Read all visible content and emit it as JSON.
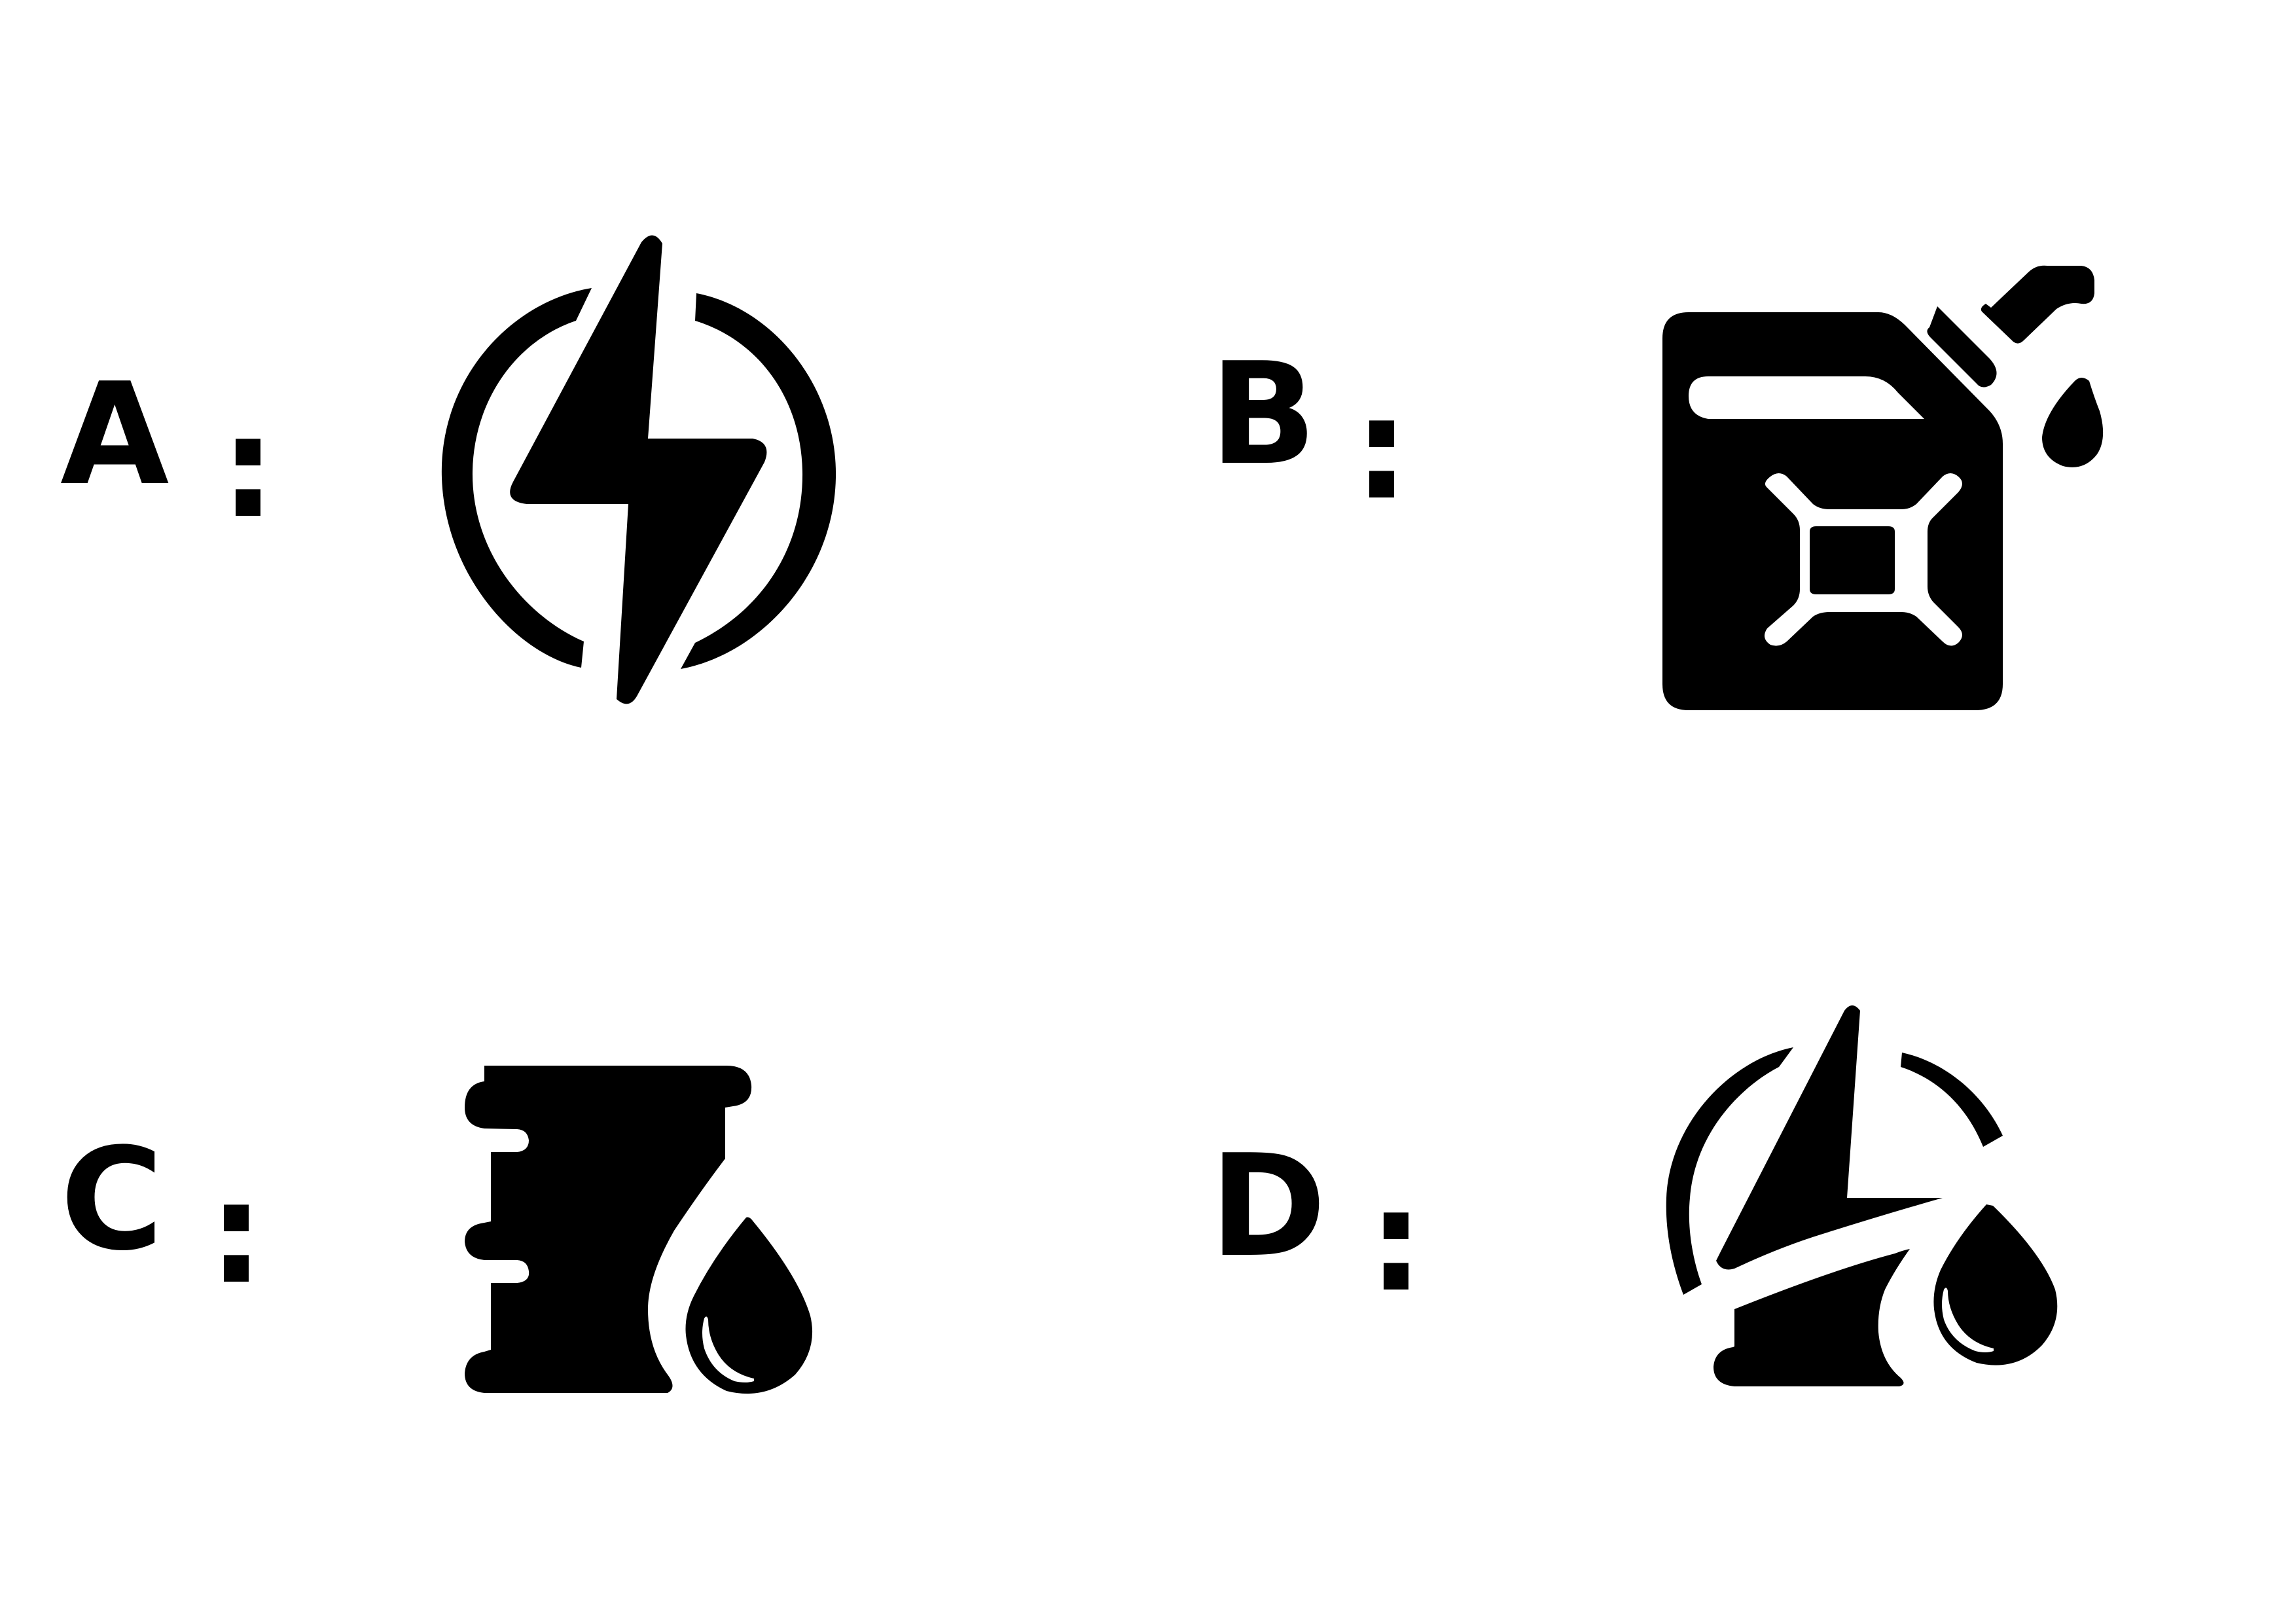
{
  "options": [
    {
      "letter": "A",
      "separator": ":",
      "icon": "energy-renewable-lightning-icon"
    },
    {
      "letter": "B",
      "separator": ":",
      "icon": "fuel-jerrycan-drip-icon"
    },
    {
      "letter": "C",
      "separator": ":",
      "icon": "fuel-can-half-with-drop-icon"
    },
    {
      "letter": "D",
      "separator": ":",
      "icon": "energy-and-fuel-combined-icon"
    }
  ],
  "colors": {
    "ink": "#000000",
    "background": "#ffffff"
  }
}
